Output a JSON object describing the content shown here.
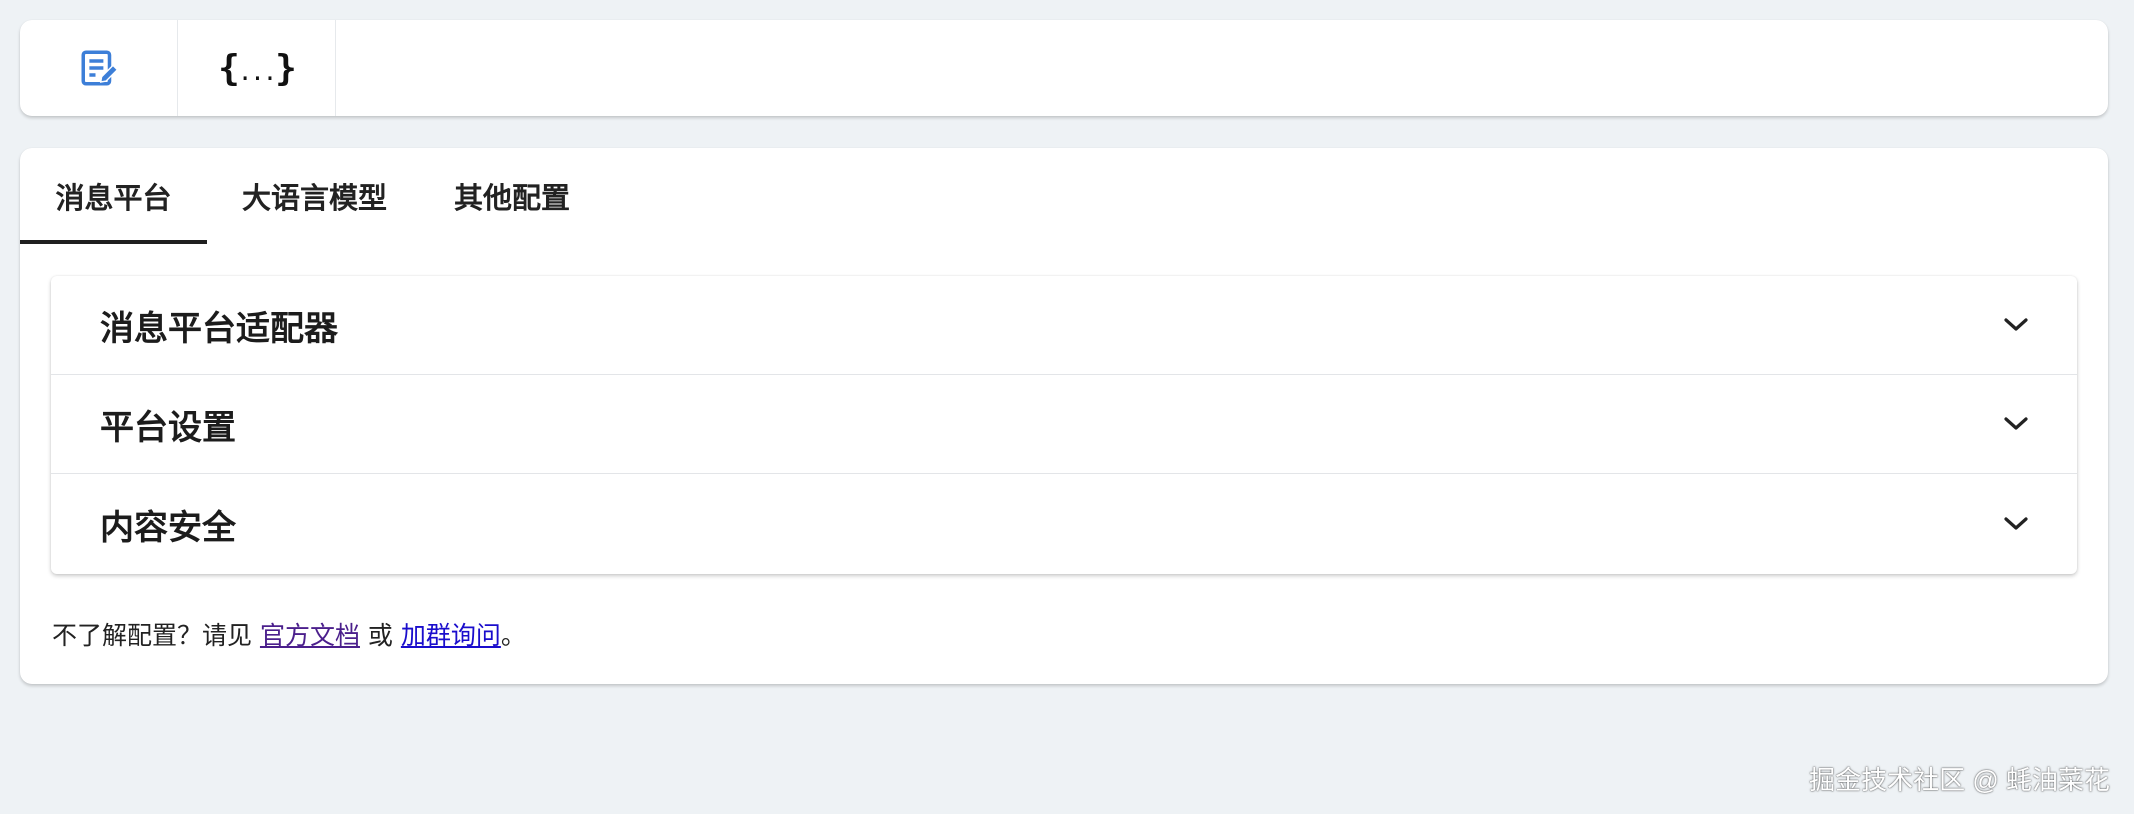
{
  "toolbar": {
    "buttons": [
      {
        "icon": "edit-note-icon",
        "label": ""
      },
      {
        "icon": "json-braces-icon",
        "glyph_open": "{",
        "glyph_dots": "...",
        "glyph_close": "}"
      }
    ],
    "accent_color": "#3d7fd8"
  },
  "tabs": [
    {
      "label": "消息平台",
      "active": true
    },
    {
      "label": "大语言模型",
      "active": false
    },
    {
      "label": "其他配置",
      "active": false
    }
  ],
  "panels": [
    {
      "title": "消息平台适配器",
      "expanded": false
    },
    {
      "title": "平台设置",
      "expanded": false
    },
    {
      "title": "内容安全",
      "expanded": false
    }
  ],
  "help": {
    "prefix": "不了解配置？请见 ",
    "link1": "官方文档",
    "middle": " 或 ",
    "link2": "加群询问",
    "suffix": "。"
  },
  "watermark": "掘金技术社区 @ 蚝油菜花"
}
